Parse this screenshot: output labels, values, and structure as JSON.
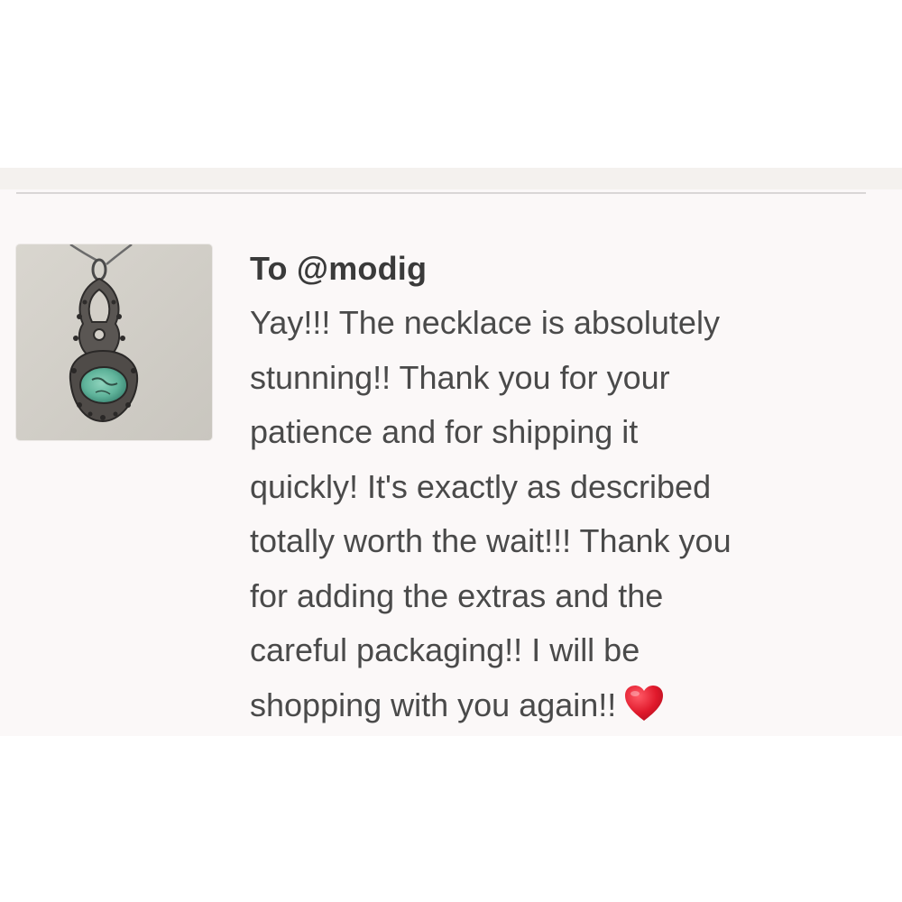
{
  "review": {
    "recipient": "To @modig",
    "message_lines": [
      "Yay!!! The necklace is absolutely",
      "stunning!! Thank you for your",
      "patience and for shipping it",
      "quickly! It's exactly as described",
      "totally worth the wait!!! Thank you",
      "for adding the extras and the",
      "careful packaging!! I will be",
      "shopping with you again!!"
    ],
    "emoji": "heart-emoji"
  },
  "thumbnail": {
    "icon": "necklace-photo"
  },
  "colors": {
    "card_bg": "#fbf8f8",
    "text": "#4a4a4a",
    "heart": "#e0192b",
    "pendant_stone": "#5fb39a"
  }
}
